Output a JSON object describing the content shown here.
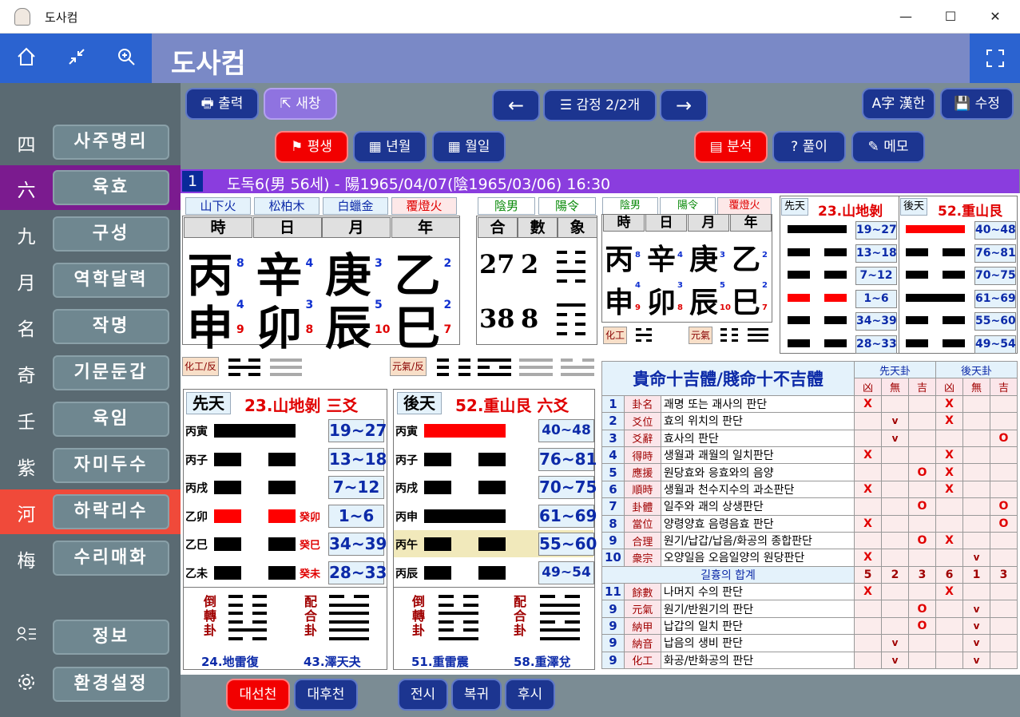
{
  "window": {
    "title": "도사컴",
    "minimize": "—",
    "maximize": "☐",
    "close": "✕"
  },
  "header": {
    "title": "도사컴",
    "home_icon": "home-icon",
    "collapse_icon": "collapse-icon",
    "zoom_icon": "zoom-in-icon",
    "fullscreen_icon": "fullscreen-icon"
  },
  "sidebar": {
    "items": [
      {
        "ch": "四",
        "label": "사주명리",
        "active": false
      },
      {
        "ch": "六",
        "label": "육효",
        "active": true
      },
      {
        "ch": "九",
        "label": "구성",
        "active": false
      },
      {
        "ch": "月",
        "label": "역학달력",
        "active": false
      },
      {
        "ch": "名",
        "label": "작명",
        "active": false
      },
      {
        "ch": "奇",
        "label": "기문둔갑",
        "active": false
      },
      {
        "ch": "壬",
        "label": "육임",
        "active": false
      },
      {
        "ch": "紫",
        "label": "자미두수",
        "active": false
      },
      {
        "ch": "河",
        "label": "하락리수",
        "active": true
      },
      {
        "ch": "梅",
        "label": "수리매화",
        "active": false
      }
    ],
    "info_label": "정보",
    "settings_label": "환경설정"
  },
  "toolbar": {
    "print": "출력",
    "new_window": "새창",
    "count": "감정 2/2개",
    "hanja": "漢한",
    "edit": "수정",
    "lifetime": "평생",
    "year_month": "년월",
    "month_day": "월일",
    "analysis": "분석",
    "solve": "풀이",
    "memo": "메모"
  },
  "info": {
    "number": "1",
    "text": "도독6(男 56세) - 陽1965/04/07(陰1965/03/06) 16:30"
  },
  "saju": {
    "nayin": [
      "山下火",
      "松柏木",
      "白蠟金",
      "覆燈火"
    ],
    "headers": [
      "時",
      "日",
      "月",
      "年"
    ],
    "stems": [
      "丙",
      "辛",
      "庚",
      "乙"
    ],
    "stem_nums": [
      "8",
      "4",
      "3",
      "2"
    ],
    "branches": [
      "申",
      "卯",
      "辰",
      "巳"
    ],
    "branch_top": [
      "4",
      "3",
      "5",
      "2"
    ],
    "branch_bot": [
      "9",
      "8",
      "10",
      "7"
    ]
  },
  "gender": {
    "labels": [
      "陰男",
      "陽令"
    ],
    "headers": [
      "合",
      "數",
      "象"
    ],
    "rows": [
      {
        "a": "27",
        "b": "2"
      },
      {
        "a": "38",
        "b": "8"
      }
    ]
  },
  "small_saju": {
    "tags": [
      "陰男",
      "陽令",
      "覆燈火"
    ],
    "headers": [
      "時",
      "日",
      "月",
      "年"
    ],
    "stems": [
      "丙",
      "辛",
      "庚",
      "乙"
    ],
    "stem_nums": [
      "8",
      "4",
      "3",
      "2"
    ],
    "branches": [
      "申",
      "卯",
      "辰",
      "巳"
    ],
    "branch_top": [
      "4",
      "3",
      "5",
      "2"
    ],
    "branch_bot": [
      "9",
      "8",
      "10",
      "7"
    ],
    "hwagong": "化工",
    "wongi": "元氣"
  },
  "mini_hex": {
    "pre_label": "先天",
    "pre_title": "23.山地剝",
    "post_label": "後天",
    "post_title": "52.重山艮",
    "pre_ranges": [
      "19~27",
      "13~18",
      "7~12",
      "1~6",
      "34~39",
      "28~33"
    ],
    "post_ranges": [
      "40~48",
      "76~81",
      "70~75",
      "61~69",
      "55~60",
      "49~54"
    ]
  },
  "tags": {
    "hwagong": "化工/反",
    "wongi": "元氣/反"
  },
  "pre": {
    "label": "先天",
    "title": "23.山地剝 三爻",
    "rows": [
      {
        "l": "丙寅",
        "r": "",
        "range": "19~27"
      },
      {
        "l": "丙子",
        "r": "",
        "range": "13~18"
      },
      {
        "l": "丙戌",
        "r": "",
        "range": "7~12"
      },
      {
        "l": "乙卯",
        "r": "癸卯",
        "range": "1~6"
      },
      {
        "l": "乙巳",
        "r": "癸巳",
        "range": "34~39"
      },
      {
        "l": "乙未",
        "r": "癸未",
        "range": "28~33"
      }
    ],
    "inv": "倒轉卦",
    "pair": "配合卦",
    "inv_name": "24.地雷復",
    "pair_name": "43.澤天夬"
  },
  "post": {
    "label": "後天",
    "title": "52.重山艮 六爻",
    "rows": [
      {
        "l": "丙寅",
        "range": "40~48"
      },
      {
        "l": "丙子",
        "range": "76~81"
      },
      {
        "l": "丙戌",
        "range": "70~75"
      },
      {
        "l": "丙申",
        "range": "61~69"
      },
      {
        "l": "丙午",
        "range": "55~60"
      },
      {
        "l": "丙辰",
        "range": "49~54"
      }
    ],
    "inv": "倒轉卦",
    "pair": "配合卦",
    "inv_name": "51.重雷震",
    "pair_name": "58.重澤兌"
  },
  "judge": {
    "title": "貴命十吉體/賤命十不吉體",
    "pre": "先天卦",
    "post": "後天卦",
    "cols": [
      "凶",
      "無",
      "吉",
      "凶",
      "無",
      "吉"
    ],
    "rows": [
      {
        "n": "1",
        "k": "卦名",
        "d": "괘명 또는 괘사의 판단",
        "v": [
          "X",
          "",
          "",
          "X",
          "",
          ""
        ]
      },
      {
        "n": "2",
        "k": "爻位",
        "d": "효의 위치의 판단",
        "v": [
          "",
          "v",
          "",
          "X",
          "",
          ""
        ]
      },
      {
        "n": "3",
        "k": "爻辭",
        "d": "효사의 판단",
        "v": [
          "",
          "v",
          "",
          "",
          "",
          "O"
        ]
      },
      {
        "n": "4",
        "k": "得時",
        "d": "생월과 괘월의 일치판단",
        "v": [
          "X",
          "",
          "",
          "X",
          "",
          ""
        ]
      },
      {
        "n": "5",
        "k": "應援",
        "d": "원당효와 응효와의 음양",
        "v": [
          "",
          "",
          "O",
          "X",
          "",
          ""
        ]
      },
      {
        "n": "6",
        "k": "順時",
        "d": "생월과 천수지수의 과소판단",
        "v": [
          "X",
          "",
          "",
          "X",
          "",
          ""
        ]
      },
      {
        "n": "7",
        "k": "卦體",
        "d": "일주와 괘의 상생판단",
        "v": [
          "",
          "",
          "O",
          "",
          "",
          "O"
        ]
      },
      {
        "n": "8",
        "k": "當位",
        "d": "양령양효 음령음효 판단",
        "v": [
          "X",
          "",
          "",
          "",
          "",
          "O"
        ]
      },
      {
        "n": "9",
        "k": "合理",
        "d": "원기/납갑/납음/화공의 종합판단",
        "v": [
          "",
          "",
          "O",
          "X",
          "",
          ""
        ]
      },
      {
        "n": "10",
        "k": "衆宗",
        "d": "오양일음 오음일양의 원당판단",
        "v": [
          "X",
          "",
          "",
          "",
          "v",
          ""
        ]
      }
    ],
    "sum_label": "길흉의 합계",
    "sums": [
      "5",
      "2",
      "3",
      "6",
      "1",
      "3"
    ],
    "rows2": [
      {
        "n": "11",
        "k": "餘數",
        "d": "나머지 수의 판단",
        "v": [
          "X",
          "",
          "",
          "X",
          "",
          ""
        ]
      },
      {
        "n": "9",
        "k": "元氣",
        "d": "원기/반원기의 판단",
        "v": [
          "",
          "",
          "O",
          "",
          "v",
          ""
        ]
      },
      {
        "n": "9",
        "k": "納甲",
        "d": "납갑의 일치 판단",
        "v": [
          "",
          "",
          "O",
          "",
          "v",
          ""
        ]
      },
      {
        "n": "9",
        "k": "納音",
        "d": "납음의 생비 판단",
        "v": [
          "",
          "v",
          "",
          "",
          "v",
          ""
        ]
      },
      {
        "n": "9",
        "k": "化工",
        "d": "화공/반화공의 판단",
        "v": [
          "",
          "v",
          "",
          "",
          "v",
          ""
        ]
      }
    ]
  },
  "bottom": {
    "b1": "대선천",
    "b2": "대후천",
    "b3": "전시",
    "b4": "복귀",
    "b5": "후시"
  }
}
